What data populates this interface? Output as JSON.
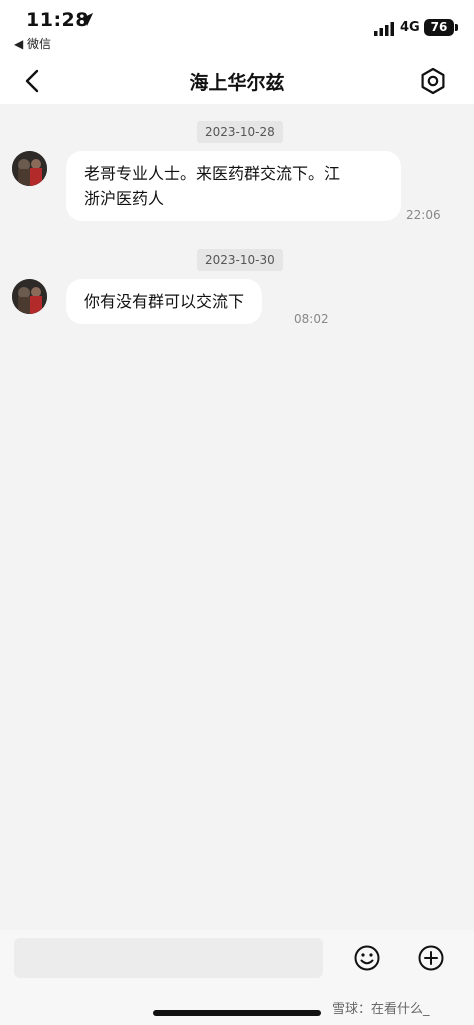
{
  "status_bar": {
    "time": "11:28",
    "back_app": "◀ 微信",
    "network": "4G",
    "battery": "76"
  },
  "nav": {
    "title": "海上华尔兹"
  },
  "messages": [
    {
      "date": "2023-10-28",
      "lines": [
        "老哥专业人士。来医药群交流下。江",
        "浙沪医药人"
      ],
      "time": "22:06"
    },
    {
      "date": "2023-10-30",
      "lines": [
        "你有没有群可以交流下"
      ],
      "time": "08:02"
    }
  ],
  "input": {
    "value": "",
    "placeholder": ""
  },
  "watermark": "雪球：在看什么_",
  "colors": {
    "background": "#f3f3f3",
    "bubble": "#ffffff",
    "date_chip": "#e6e6e6",
    "text": "#111111"
  }
}
